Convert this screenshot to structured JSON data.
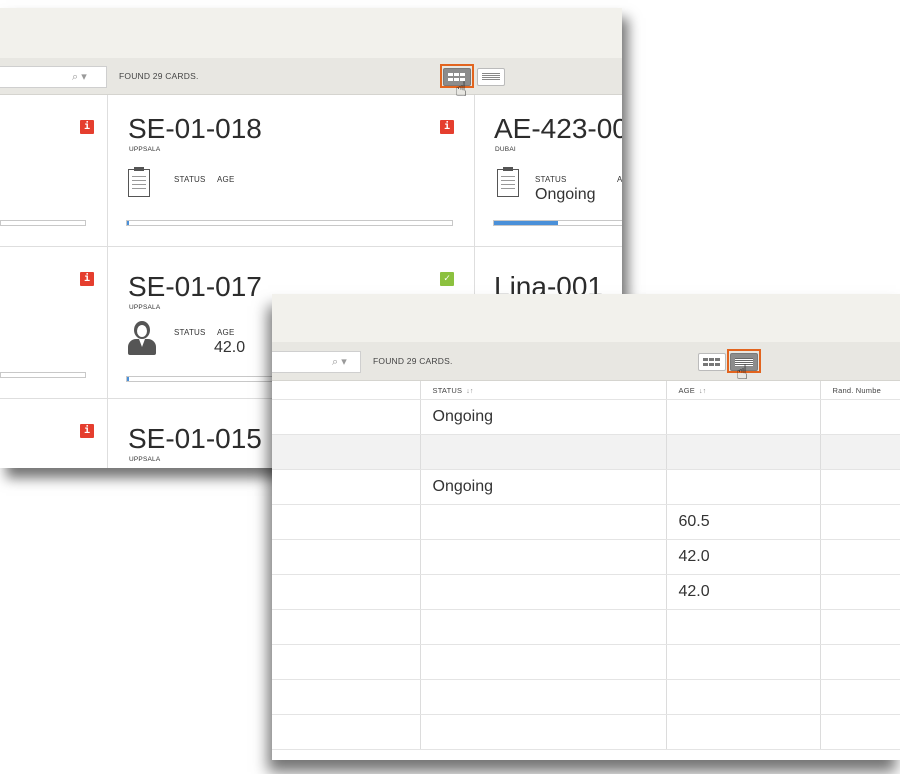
{
  "card_view": {
    "toolbar": {
      "found_text": "FOUND 29 CARDS.",
      "search_icon": "search-dropdown-icon"
    },
    "cards": [
      {
        "id": "SE-01-018",
        "location": "UPPSALA",
        "status_label": "STATUS",
        "age_label": "AGE",
        "status": "",
        "age": "",
        "badge": "i",
        "progress": 0.0
      },
      {
        "id": "AE-423-00",
        "location": "DUBAI",
        "status_label": "STATUS",
        "age_label": "A",
        "status": "Ongoing",
        "age": "",
        "badge": "",
        "progress": 0.5
      },
      {
        "id": "SE-01-017",
        "location": "UPPSALA",
        "status_label": "STATUS",
        "age_label": "AGE",
        "status": "",
        "age": "42.0",
        "badge": "✓",
        "progress": 0.0
      },
      {
        "id": "Lina-001",
        "location": "",
        "badge": ""
      },
      {
        "id": "SE-01-015",
        "location": "UPPSALA",
        "badge": ""
      }
    ],
    "left_badges": [
      "i",
      "i",
      "i"
    ]
  },
  "list_view": {
    "toolbar": {
      "found_text": "FOUND 29 CARDS."
    },
    "columns": [
      {
        "label": "STATUS",
        "sortable": true
      },
      {
        "label": "AGE",
        "sortable": true
      },
      {
        "label": "Rand. Numbe",
        "sortable": false
      }
    ],
    "rows": [
      {
        "status": "Ongoing",
        "age": ""
      },
      {
        "status": "",
        "age": ""
      },
      {
        "status": "Ongoing",
        "age": ""
      },
      {
        "status": "",
        "age": "60.5"
      },
      {
        "status": "",
        "age": "42.0"
      },
      {
        "status": "",
        "age": "42.0"
      },
      {
        "status": "",
        "age": ""
      },
      {
        "status": "",
        "age": ""
      },
      {
        "status": "",
        "age": ""
      },
      {
        "status": "",
        "age": ""
      }
    ]
  },
  "colors": {
    "accent_highlight": "#e2641e",
    "info_badge": "#e53e2e",
    "ok_badge": "#8cc13f",
    "progress": "#4a90d9"
  }
}
